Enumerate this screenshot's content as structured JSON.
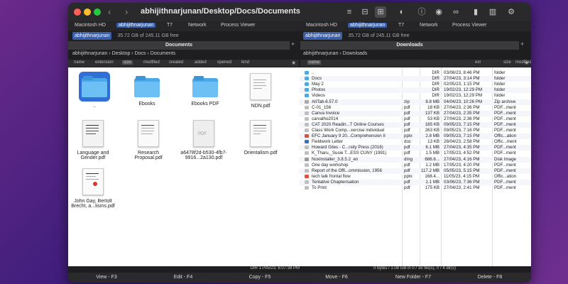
{
  "window": {
    "title": "abhijithnarjunan/Desktop/Docs/Documents"
  },
  "toolbar": {
    "back_icon": "chevron-left-icon",
    "forward_icon": "chevron-right-icon"
  },
  "favorites": [
    {
      "label": "Macintosh HD"
    },
    {
      "label": "abhijithnarjunan"
    },
    {
      "label": "T7"
    },
    {
      "label": "Network"
    },
    {
      "label": "Process Viewer"
    }
  ],
  "favorites_right": [
    {
      "label": "Macintosh HD"
    },
    {
      "label": "abhijithnarjunan"
    },
    {
      "label": "T7"
    },
    {
      "label": "Network"
    },
    {
      "label": "Process Viewer"
    }
  ],
  "left": {
    "drive_chip": "abhijithnarjunan",
    "free": "35.72 GB of 245.11 GB free",
    "tab": "Documents",
    "breadcrumbs": [
      "abhijithnarjunan",
      "Desktop",
      "Docs",
      "Documents"
    ],
    "columns": [
      "name",
      "extension",
      "size",
      "modified",
      "created",
      "added",
      "opened",
      "kind"
    ],
    "items": [
      {
        "label": "..",
        "type": "folder",
        "selected": true
      },
      {
        "label": "Ebooks",
        "type": "folder"
      },
      {
        "label": "Ebooks PDF",
        "type": "folder"
      },
      {
        "label": "NDN.pdf",
        "type": "doc"
      },
      {
        "label": "Language and Gender.pdf",
        "type": "doc"
      },
      {
        "label": "Research Proposal.pdf",
        "type": "doc"
      },
      {
        "label": "a6478f2d-b530-4fb7-9916...2a130.pdf",
        "type": "doc"
      },
      {
        "label": "Orientalism.pdf",
        "type": "doc"
      },
      {
        "label": "John Gay, Bertolt Brecht, a...lisms.pdf",
        "type": "doc"
      }
    ],
    "status": "DIR   17/05/23, 6:07:38 PM"
  },
  "right": {
    "drive_chip": "abhijithnarjunan",
    "free": "35.72 GB of 245.11 GB free",
    "tab": "Downloads",
    "breadcrumbs": [
      "abhijithnarjunan",
      "Downloads"
    ],
    "columns": [
      "name",
      "ext",
      "size",
      "modified",
      "kind"
    ],
    "rows": [
      {
        "name": "..",
        "ext": "",
        "size": "DIR",
        "modified": "03/06/23, 8:46 PM",
        "kind": "folder",
        "icon": "folder"
      },
      {
        "name": "Docs",
        "ext": "",
        "size": "DIR",
        "modified": "27/04/23, 3:14 PM",
        "kind": "folder",
        "icon": "folder"
      },
      {
        "name": "May 2",
        "ext": "",
        "size": "DIR",
        "modified": "02/05/23, 1:15 PM",
        "kind": "folder",
        "icon": "folder"
      },
      {
        "name": "Photos",
        "ext": "",
        "size": "DIR",
        "modified": "19/02/23, 12:29 PM",
        "kind": "folder",
        "icon": "folder"
      },
      {
        "name": "Videos",
        "ext": "",
        "size": "DIR",
        "modified": "19/02/23, 12:29 PM",
        "kind": "folder",
        "icon": "folder"
      },
      {
        "name": "AltTab-6.57.0",
        "ext": "zip",
        "size": "8.8 MB",
        "modified": "04/04/23, 10:26 PM",
        "kind": "Zip archive",
        "icon": "zip"
      },
      {
        "name": "C-01_156",
        "ext": "pdf",
        "size": "18 KB",
        "modified": "27/04/23, 2:36 PM",
        "kind": "PDF...ment",
        "icon": "pdf"
      },
      {
        "name": "Canva Invoice",
        "ext": "pdf",
        "size": "137 KB",
        "modified": "27/04/23, 2:35 PM",
        "kind": "PDF...ment",
        "icon": "pdf"
      },
      {
        "name": "carvalho2014",
        "ext": "pdf",
        "size": "53 KB",
        "modified": "27/04/23, 2:36 PM",
        "kind": "PDF...ment",
        "icon": "pdf"
      },
      {
        "name": "CAT 2020 Readin...T Online Courses",
        "ext": "pdf",
        "size": "185 KB",
        "modified": "09/05/23, 7:15 PM",
        "kind": "PDF...ment",
        "icon": "pdf"
      },
      {
        "name": "Class Work Comp...xercise individual",
        "ext": "pdf",
        "size": "263 KB",
        "modified": "09/05/23, 7:16 PM",
        "kind": "PDF...ment",
        "icon": "pdf"
      },
      {
        "name": "EFC January 9 20...Comprehension II",
        "ext": "pptx",
        "size": "2.8 MB",
        "modified": "09/05/23, 7:15 PM",
        "kind": "Offic...ation",
        "icon": "ppt"
      },
      {
        "name": "Fieldwork Letter",
        "ext": "doc",
        "size": "13 KB",
        "modified": "28/04/23, 2:58 PM",
        "kind": "Offic...ment",
        "icon": "doc"
      },
      {
        "name": "Howard Giles - C...rsity Press (2016)",
        "ext": "pdf",
        "size": "6.1 MB",
        "modified": "27/04/23, 4:35 PM",
        "kind": "PDF...ment",
        "icon": "pdf"
      },
      {
        "name": "K_Tharu,_Susie T...ESS CUNY (1991)",
        "ext": "pdf",
        "size": "1.5 MB",
        "modified": "17/05/23, 4:52 PM",
        "kind": "PDF...ment",
        "icon": "pdf"
      },
      {
        "name": "NoxInstaller_3.8.5.2_en",
        "ext": "dmg",
        "size": "686.6...",
        "modified": "27/04/23, 4:16 PM",
        "kind": "Disk Image",
        "icon": "dmg"
      },
      {
        "name": "One day workshop",
        "ext": "pdf",
        "size": "1.2 MB",
        "modified": "17/05/23, 4:20 PM",
        "kind": "PDF...ment",
        "icon": "pdf"
      },
      {
        "name": "Report of the Offi...ommission, 1956",
        "ext": "pdf",
        "size": "117.2 MB",
        "modified": "05/05/23, 5:15 PM",
        "kind": "PDF...ment",
        "icon": "pdf"
      },
      {
        "name": "tech talk frontal flow",
        "ext": "pptx",
        "size": "168.4...",
        "modified": "11/05/23, 4:15 PM",
        "kind": "Offic...ation",
        "icon": "ppt"
      },
      {
        "name": "Tentative Chapterisation",
        "ext": "pdf",
        "size": "1.1 MB",
        "modified": "03/06/23, 7:36 PM",
        "kind": "PDF...ment",
        "icon": "pdf"
      },
      {
        "name": "To Print",
        "ext": "pdf",
        "size": "175 KB",
        "modified": "27/04/23, 2:41 PM",
        "kind": "PDF...ment",
        "icon": "pdf"
      }
    ],
    "status": "0 bytes / 1.08 GB in 0 / 16 file(s), 0 / 4 dir(s)"
  },
  "function_keys": [
    "View - F3",
    "Edit - F4",
    "Copy - F5",
    "Move - F6",
    "New Folder - F7",
    "Delete - F8"
  ],
  "colors": {
    "accent": "#3a5fa8",
    "folder": "#4aa8e8",
    "selection": "#2f6fd6"
  }
}
